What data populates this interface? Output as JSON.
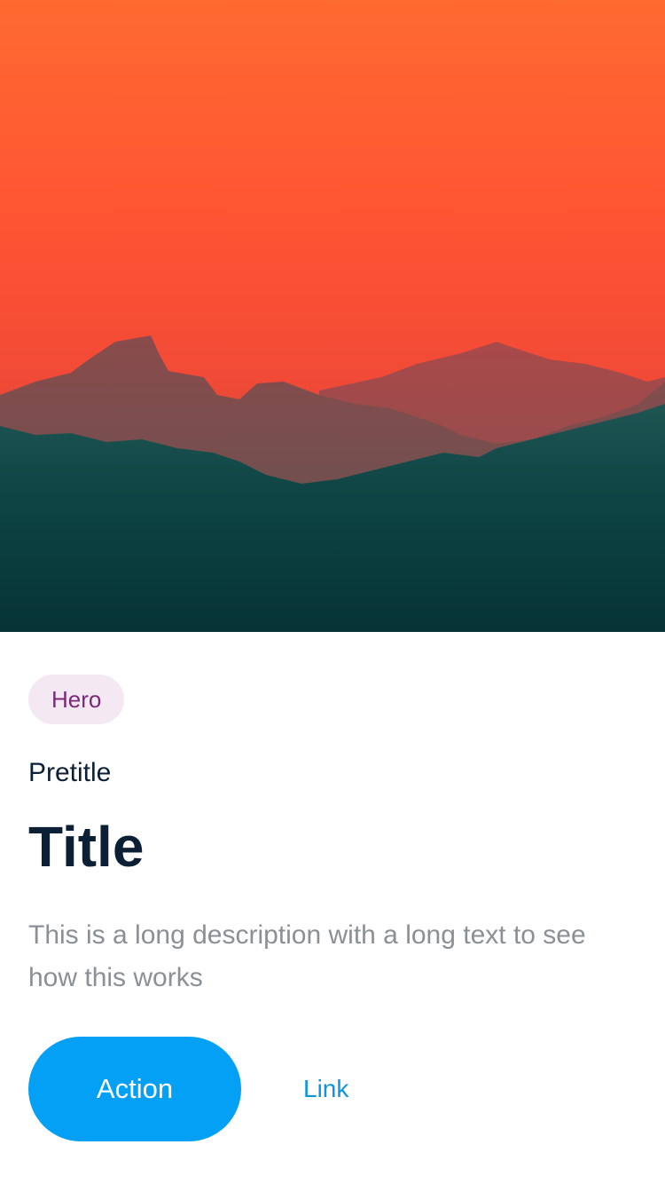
{
  "card": {
    "tag": "Hero",
    "pretitle": "Pretitle",
    "title": "Title",
    "description": "This is a long description with a long text to see how this works"
  },
  "actions": {
    "primary_label": "Action",
    "link_label": "Link"
  },
  "colors": {
    "primary": "#03a0f6",
    "link": "#0a96e0",
    "tag_background": "#f4e9f3",
    "tag_text": "#7a2a78",
    "title_text": "#0b2035",
    "description_text": "#8a9096"
  },
  "image": {
    "semantic": "mountain-sunset-image"
  }
}
